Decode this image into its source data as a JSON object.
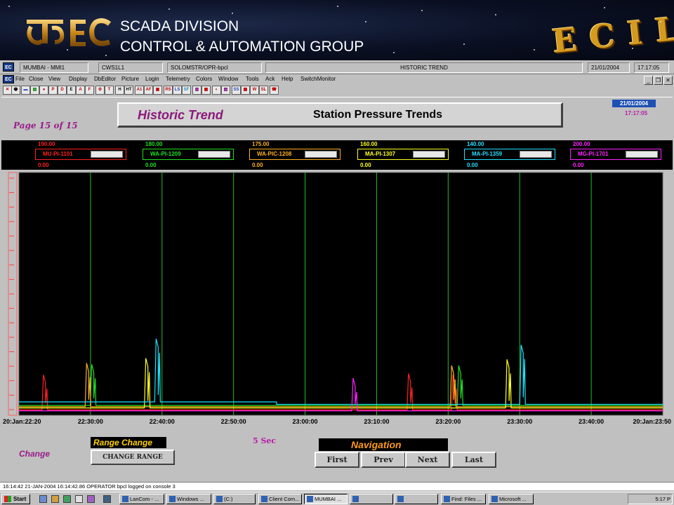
{
  "banner": {
    "line1": "SCADA DIVISION",
    "line2": "CONTROL & AUTOMATION GROUP",
    "logo_left": "इका EC",
    "logo_right": "ECIL"
  },
  "titlebar": {
    "icon": "EC",
    "station": "MUMBAI - MMI1",
    "node": "CWS1L1",
    "user": "SOLOMSTR/OPR-bpcl",
    "title": "HISTORIC TREND",
    "date": "21/01/2004",
    "time": "17:17:05"
  },
  "menu": [
    "File",
    "Close",
    "View",
    "Display",
    "DbEditor",
    "Picture",
    "Login",
    "Telemetry",
    "Colors",
    "Window",
    "Tools",
    "Ack",
    "Help",
    "SwitchMonitor"
  ],
  "toolbar": {
    "buttons": [
      {
        "label": "✕",
        "color": "#c00000",
        "name": "close-tool-icon"
      },
      {
        "label": "🖶",
        "color": "#000000",
        "name": "print-tool-icon"
      },
      {
        "label": "▬",
        "color": "#2040c0",
        "name": "display-tool-icon"
      },
      {
        "label": "▤",
        "color": "#008000",
        "name": "picture-tool-icon"
      },
      {
        "label": "●",
        "color": "#c00000",
        "name": "alarm-tool-icon"
      },
      {
        "label": "P",
        "color": "#c00000",
        "name": "p-tool-icon"
      },
      {
        "label": "D",
        "color": "#c00000",
        "name": "d-tool-icon"
      },
      {
        "label": "E",
        "color": "#000000",
        "name": "e-tool-icon"
      },
      {
        "label": "A",
        "color": "#c00000",
        "name": "a-tool-icon"
      },
      {
        "label": "F",
        "color": "#c00000",
        "name": "f-tool-icon"
      },
      {
        "label": "⚙",
        "color": "#c00000",
        "name": "config-tool-icon"
      },
      {
        "label": "T",
        "color": "#c00000",
        "name": "t-tool-icon"
      },
      {
        "label": "H",
        "color": "#000000",
        "name": "h-tool-icon"
      },
      {
        "label": "HT",
        "color": "#000000",
        "name": "ht-tool-icon"
      },
      {
        "label": "A1",
        "color": "#c00000",
        "name": "a1-tool-icon"
      },
      {
        "label": "AF",
        "color": "#c00000",
        "name": "af-tool-icon"
      },
      {
        "label": "▣",
        "color": "#c00000",
        "name": "grid-tool-icon"
      },
      {
        "label": "RS",
        "color": "#c00000",
        "name": "rs-tool-icon"
      },
      {
        "label": "LS",
        "color": "#2040c0",
        "name": "ls-tool-icon"
      },
      {
        "label": "SF",
        "color": "#2090c0",
        "name": "sf-tool-icon"
      },
      {
        "label": "▥",
        "color": "#800080",
        "name": "report-tool-icon"
      },
      {
        "label": "▦",
        "color": "#c00000",
        "name": "report2-tool-icon"
      },
      {
        "label": "◐",
        "color": "#c00000",
        "name": "trend-tool-icon"
      },
      {
        "label": "▧",
        "color": "#800080",
        "name": "trend2-tool-icon"
      },
      {
        "label": "SS",
        "color": "#2040c0",
        "name": "ss-tool-icon"
      },
      {
        "label": "▩",
        "color": "#c00000",
        "name": "window-tool-icon"
      },
      {
        "label": "W",
        "color": "#c00000",
        "name": "w-tool-icon"
      },
      {
        "label": "SL",
        "color": "#c00000",
        "name": "sl-tool-icon"
      },
      {
        "label": "☎",
        "color": "#c00000",
        "name": "phone-tool-icon"
      }
    ]
  },
  "header": {
    "title": "Historic Trend",
    "subtitle": "Station Pressure Trends",
    "date": "21/01/2004",
    "time": "17:17:05",
    "page": "Page 15 of 15"
  },
  "legend": [
    {
      "tag": "MU-PI-1101",
      "max": "190.00",
      "min": "0.00",
      "color": "#ff2020"
    },
    {
      "tag": "WA-PI-1209",
      "max": "180.00",
      "min": "0.00",
      "color": "#20e020"
    },
    {
      "tag": "WA-PIC-1208",
      "max": "175.00",
      "min": "0.00",
      "color": "#ffb020"
    },
    {
      "tag": "MA-PI-1307",
      "max": "160.00",
      "min": "0.00",
      "color": "#ffff20"
    },
    {
      "tag": "MA-PI-1359",
      "max": "140.00",
      "min": "0.00",
      "color": "#20e0ff"
    },
    {
      "tag": "MG-PI-1701",
      "max": "200.00",
      "min": "0.00",
      "color": "#ff20ff"
    }
  ],
  "chart_data": {
    "type": "line",
    "x_ticks": [
      "20:Jan:22:20",
      "22:30:00",
      "22:40:00",
      "22:50:00",
      "23:00:00",
      "23:10:00",
      "23:20:00",
      "23:30:00",
      "23:40:00",
      "20:Jan:23:50"
    ],
    "grid": "vertical",
    "series": [
      {
        "name": "MU-PI-1101",
        "color": "#ff2020",
        "baseline": 0.022,
        "spikes": [
          {
            "at": 0.038,
            "height": 0.145
          },
          {
            "at": 0.605,
            "height": 0.15
          },
          {
            "at": 0.674,
            "height": 0.145
          }
        ]
      },
      {
        "name": "WA-PI-1209",
        "color": "#20e020",
        "baseline": 0.04,
        "spikes": [
          {
            "at": 0.113,
            "height": 0.17
          },
          {
            "at": 0.683,
            "height": 0.165
          }
        ]
      },
      {
        "name": "WA-PIC-1208",
        "color": "#ffb020",
        "baseline": 0.035,
        "spikes": [
          {
            "at": 0.105,
            "height": 0.18
          },
          {
            "at": 0.672,
            "height": 0.17
          }
        ]
      },
      {
        "name": "MA-PI-1307",
        "color": "#ffff20",
        "baseline": 0.03,
        "spikes": [
          {
            "at": 0.197,
            "height": 0.205
          },
          {
            "at": 0.758,
            "height": 0.2
          }
        ]
      },
      {
        "name": "MA-PI-1359",
        "color": "#20e0ff",
        "baseline": 0.055,
        "step_at": 0.4,
        "baseline_after": 0.045,
        "spikes": [
          {
            "at": 0.213,
            "height": 0.26
          },
          {
            "at": 0.78,
            "height": 0.245
          }
        ]
      },
      {
        "name": "MG-PI-1701",
        "color": "#ff20ff",
        "baseline": 0.018,
        "spikes": [
          {
            "at": 0.519,
            "height": 0.135
          }
        ]
      }
    ]
  },
  "controls": {
    "change": "Change",
    "range_label": "Range Change",
    "range_button": "CHANGE RANGE",
    "interval": "5 Sec",
    "navigation": "Navigation",
    "first": "First",
    "prev": "Prev",
    "next": "Next",
    "last": "Last"
  },
  "status": "16:14:42 21-JAN-2004 16:14:42.86 OPERATOR bpcl logged on console 3",
  "taskbar": {
    "start": "Start",
    "tasks": [
      "LanCom - ...",
      "Windows ...",
      "(C:)",
      "Client Com...",
      "MUMBAI ...",
      "",
      "",
      "Find: Files ...",
      "Microsoft ..."
    ],
    "clock": "5:17 P"
  }
}
